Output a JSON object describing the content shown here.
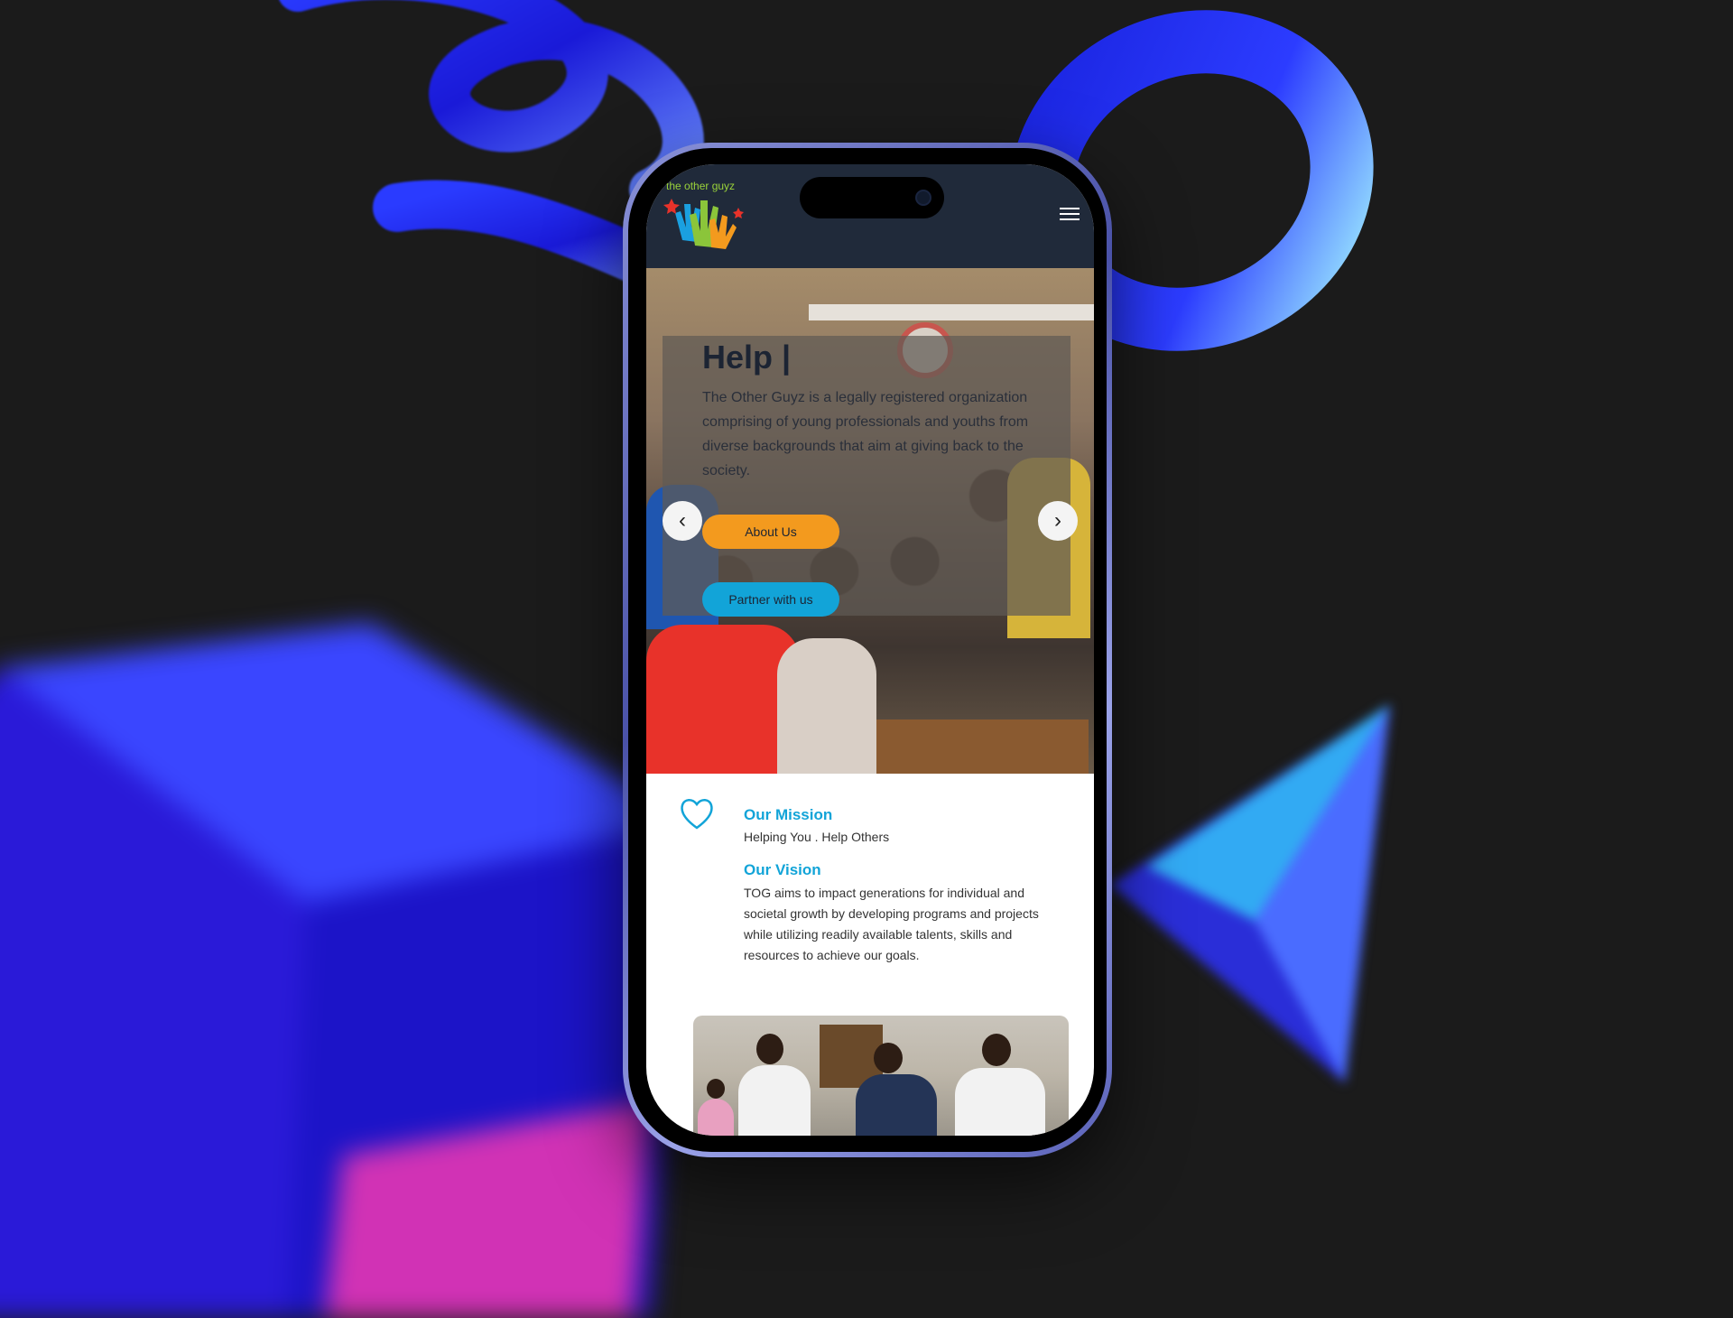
{
  "nav": {
    "logo_text": "the other guyz",
    "menu_icon": "hamburger-icon"
  },
  "hero": {
    "title": "Help |",
    "description": "The Other Guyz is a legally registered organization comprising of young professionals and youths from diverse backgrounds that aim at giving back to the society.",
    "about_button": "About Us",
    "partner_button": "Partner with us",
    "prev_arrow": "‹",
    "next_arrow": "›"
  },
  "mission": {
    "icon": "heart-icon",
    "mission_title": "Our Mission",
    "mission_text": "Helping You . Help Others",
    "vision_title": "Our Vision",
    "vision_text": "TOG aims to impact generations for individual and societal growth by developing programs and projects while utilizing readily available talents, skills and resources to achieve our goals."
  },
  "colors": {
    "navbar": "#202a3a",
    "accent_blue": "#12a4d8",
    "accent_orange": "#f39a1e",
    "background": "#1b1b1b"
  }
}
